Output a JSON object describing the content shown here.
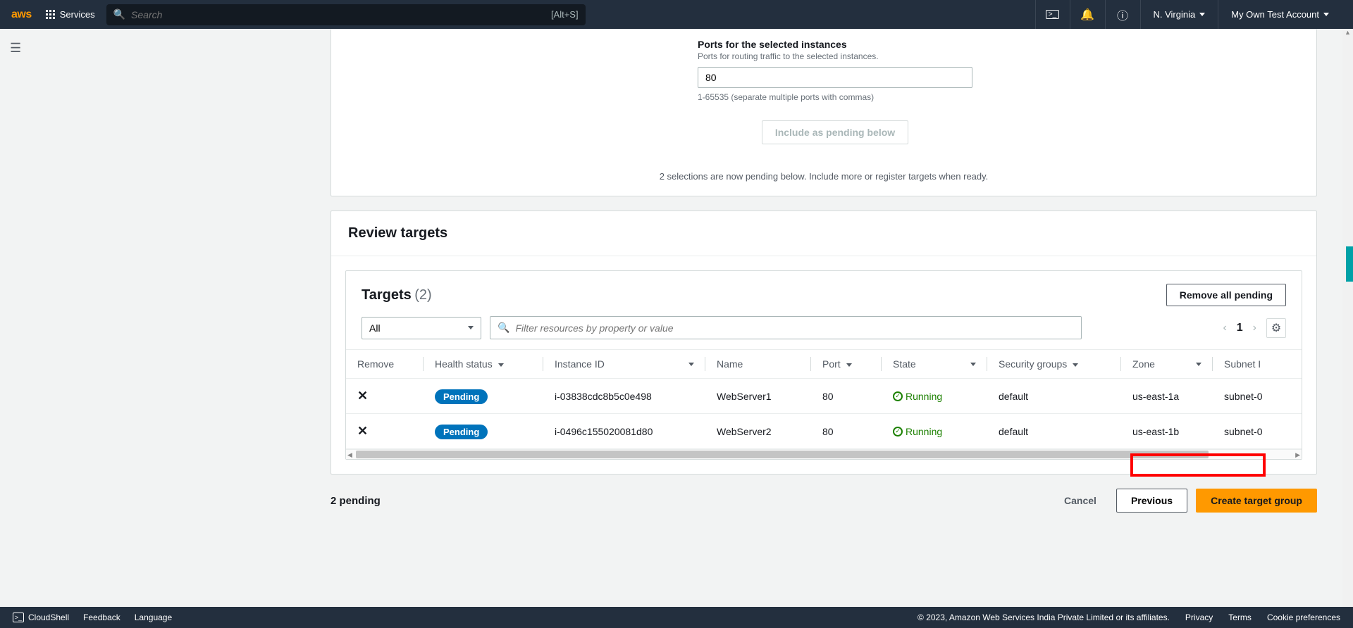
{
  "nav": {
    "logo": "aws",
    "services": "Services",
    "search_placeholder": "Search",
    "search_hint": "[Alt+S]",
    "region": "N. Virginia",
    "account": "My Own Test Account"
  },
  "ports": {
    "title": "Ports for the selected instances",
    "sub": "Ports for routing traffic to the selected instances.",
    "value": "80",
    "hint": "1-65535 (separate multiple ports with commas)",
    "include_btn": "Include as pending below",
    "selections_text": "2 selections are now pending below. Include more or register targets when ready."
  },
  "review": {
    "header": "Review targets",
    "targets_label": "Targets",
    "targets_count": "(2)",
    "remove_all": "Remove all pending",
    "filter_all": "All",
    "filter_placeholder": "Filter resources by property or value",
    "page": "1"
  },
  "columns": {
    "remove": "Remove",
    "health": "Health status",
    "instance": "Instance ID",
    "name": "Name",
    "port": "Port",
    "state": "State",
    "sg": "Security groups",
    "zone": "Zone",
    "subnet": "Subnet I"
  },
  "rows": [
    {
      "health": "Pending",
      "instance": "i-03838cdc8b5c0e498",
      "name": "WebServer1",
      "port": "80",
      "state": "Running",
      "sg": "default",
      "zone": "us-east-1a",
      "subnet": "subnet-0"
    },
    {
      "health": "Pending",
      "instance": "i-0496c155020081d80",
      "name": "WebServer2",
      "port": "80",
      "state": "Running",
      "sg": "default",
      "zone": "us-east-1b",
      "subnet": "subnet-0"
    }
  ],
  "actions": {
    "pending": "2 pending",
    "cancel": "Cancel",
    "previous": "Previous",
    "create": "Create target group"
  },
  "footer": {
    "cloudshell": "CloudShell",
    "feedback": "Feedback",
    "language": "Language",
    "copyright": "© 2023, Amazon Web Services India Private Limited or its affiliates.",
    "privacy": "Privacy",
    "terms": "Terms",
    "cookie": "Cookie preferences"
  }
}
